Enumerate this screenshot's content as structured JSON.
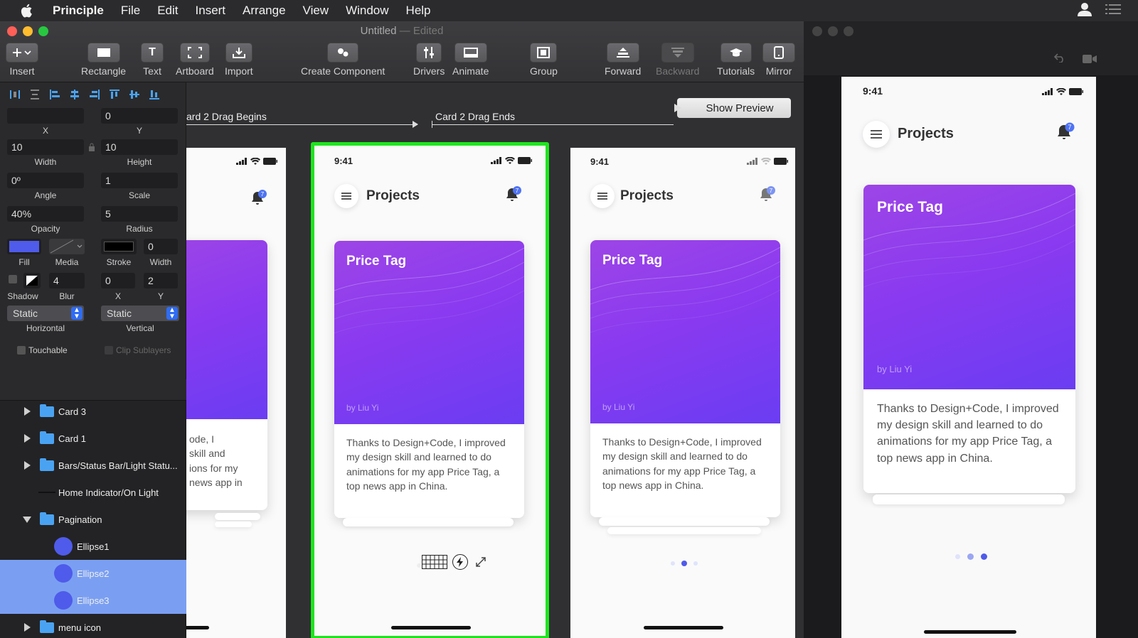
{
  "menubar": {
    "app": "Principle",
    "items": [
      "File",
      "Edit",
      "Insert",
      "Arrange",
      "View",
      "Window",
      "Help"
    ]
  },
  "window": {
    "title": "Untitled",
    "edited": "— Edited"
  },
  "toolbar": {
    "insert": "Insert",
    "rectangle": "Rectangle",
    "text": "Text",
    "artboard": "Artboard",
    "import": "Import",
    "create_component": "Create Component",
    "drivers": "Drivers",
    "animate": "Animate",
    "group": "Group",
    "forward": "Forward",
    "backward": "Backward",
    "tutorials": "Tutorials",
    "mirror": "Mirror"
  },
  "inspector": {
    "x_value": "",
    "x_label": "X",
    "y_value": "0",
    "y_label": "Y",
    "width_value": "10",
    "width_label": "Width",
    "height_value": "10",
    "height_label": "Height",
    "angle_value": "0º",
    "angle_label": "Angle",
    "scale_value": "1",
    "scale_label": "Scale",
    "opacity_value": "40%",
    "opacity_label": "Opacity",
    "radius_value": "5",
    "radius_label": "Radius",
    "fill_label": "Fill",
    "media_label": "Media",
    "stroke_label": "Stroke",
    "stroke_width_value": "0",
    "stroke_width_label": "Width",
    "shadow_label": "Shadow",
    "blur_value": "4",
    "blur_label": "Blur",
    "shadow_x_value": "0",
    "shadow_x_label": "X",
    "shadow_y_value": "2",
    "shadow_y_label": "Y",
    "horizontal_value": "Static",
    "horizontal_label": "Horizontal",
    "vertical_value": "Static",
    "vertical_label": "Vertical",
    "touchable_label": "Touchable",
    "clip_label": "Clip Sublayers",
    "colors": {
      "fill": "#4f5bea",
      "stroke": "#000000"
    }
  },
  "layers": [
    {
      "label": "Card 3",
      "type": "folder",
      "expanded": false
    },
    {
      "label": "Card 1",
      "type": "folder",
      "expanded": false
    },
    {
      "label": "Bars/Status Bar/Light Statu...",
      "type": "folder",
      "expanded": false
    },
    {
      "label": "Home Indicator/On Light",
      "type": "line"
    },
    {
      "label": "Pagination",
      "type": "folder",
      "expanded": true
    },
    {
      "label": "Ellipse1",
      "type": "ellipse",
      "selected": false
    },
    {
      "label": "Ellipse2",
      "type": "ellipse",
      "selected": true
    },
    {
      "label": "Ellipse3",
      "type": "ellipse",
      "selected": true
    },
    {
      "label": "menu icon",
      "type": "folder",
      "expanded": false
    }
  ],
  "canvas": {
    "trigger1": "ard 2 Drag Begins",
    "trigger2": "Card 2 Drag Ends",
    "show_preview": "Show Preview"
  },
  "phone": {
    "time": "9:41",
    "title": "Projects",
    "badge": "7",
    "card_title": "Price Tag",
    "card_author": "by Liu Yi",
    "card_text": "Thanks to Design+Code, I improved my design skill and learned to do animations for my app Price Tag, a top news app in China.",
    "left_text": "ode, I\nskill and\nions for my\nnews app in"
  },
  "colors": {
    "selection": "#1ee51e",
    "accent": "#2f6cf4",
    "card_gradient_start": "#9d45e6",
    "card_gradient_end": "#6a3df2"
  }
}
